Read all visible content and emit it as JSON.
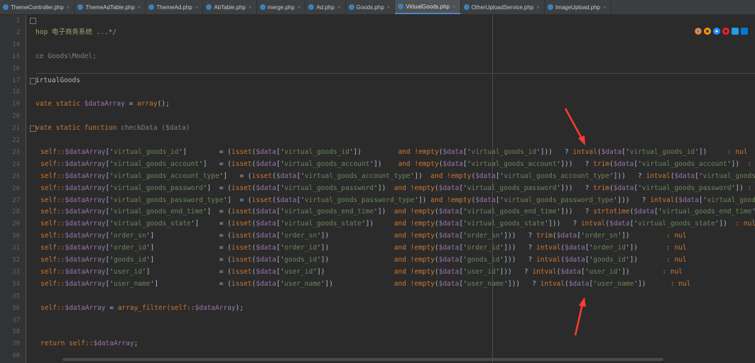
{
  "tabs": [
    {
      "label": "ThemeController.php",
      "active": false
    },
    {
      "label": "ThemeAdTable.php",
      "active": false
    },
    {
      "label": "ThemeAd.php",
      "active": false
    },
    {
      "label": "AbTable.php",
      "active": false
    },
    {
      "label": "merge.php",
      "active": false
    },
    {
      "label": "Ad.php",
      "active": false
    },
    {
      "label": "Goods.php",
      "active": false
    },
    {
      "label": "VirtualGoods.php",
      "active": true
    },
    {
      "label": "OtherUploadService.php",
      "active": false
    },
    {
      "label": "ImageUpload.php",
      "active": false
    }
  ],
  "line_numbers": [
    "1",
    "2",
    "14",
    "15",
    "16",
    "17",
    "18",
    "19",
    "20",
    "21",
    "22",
    "23",
    "24",
    "25",
    "26",
    "27",
    "28",
    "29",
    "30",
    "31",
    "32",
    "33",
    "34",
    "35",
    "36",
    "37",
    "38",
    "39",
    "40"
  ],
  "code": {
    "l2": "hop 电子商务系统 ...*/",
    "l15": "ce Goods\\Model;",
    "l17": "irtualGoods",
    "l19a": "vate static ",
    "l19b": "$dataArray",
    "l19c": " = ",
    "l19d": "array",
    "l19e": "();",
    "l21a": "vate static function ",
    "l21b": "checkData ($data)",
    "rows": [
      {
        "key": "virtual_goods_id",
        "pad": "        ",
        "pad2": "         ",
        "fn": "intval",
        "k": "virtual_goods_id",
        "tail": "     : nul"
      },
      {
        "key": "virtual_goods_account",
        "pad": "   ",
        "pad2": "    ",
        "fn": "trim",
        "k": "virtual_goods_account",
        "tail": "  : nul"
      },
      {
        "key": "virtual_goods_account_type",
        "pad": "   ",
        "pad2": "  ",
        "fn": "intval",
        "k": "virtual_goods_",
        "tail": ""
      },
      {
        "key": "virtual_goods_password",
        "pad": "  ",
        "pad2": "  ",
        "fn": "trim",
        "k": "virtual_goods_password",
        "tail": " : nul"
      },
      {
        "key": "virtual_goods_password_type",
        "pad": "  ",
        "pad2": " ",
        "fn": "intval",
        "k": "virtual_goods_",
        "tail": ""
      },
      {
        "key": "virtual_goods_end_time",
        "pad": "  ",
        "pad2": "  ",
        "fn": "strtotime",
        "k": "virtual_goods_end_time",
        "tail": " : nul"
      },
      {
        "key": "virtual_goods_state",
        "pad": "     ",
        "pad2": "     ",
        "fn": "intval",
        "k": "virtual_goods_state",
        "tail": "  : nul"
      },
      {
        "key": "order_sn",
        "pad": "                ",
        "pad2": "                ",
        "fn": "trim",
        "k": "order_sn",
        "tail": "         : nul"
      },
      {
        "key": "order_id",
        "pad": "                ",
        "pad2": "                ",
        "fn": "intval",
        "k": "order_id",
        "tail": "       : nul"
      },
      {
        "key": "goods_id",
        "pad": "                ",
        "pad2": "                ",
        "fn": "intval",
        "k": "goods_id",
        "tail": "       : nul"
      },
      {
        "key": "user_id",
        "pad": "                 ",
        "pad2": "                 ",
        "fn": "intval",
        "k": "user_id",
        "tail": "        : nul"
      },
      {
        "key": "user_name",
        "pad": "               ",
        "pad2": "               ",
        "fn": "intval",
        "k": "user_name",
        "tail": "      : nul"
      }
    ],
    "l36a": "self::",
    "l36b": "$dataArray",
    "l36c": " = ",
    "l36d": "array_filter",
    "l36e": "(self::",
    "l36f": "$dataArray",
    "l36g": ");",
    "l39a": "return ",
    "l39b": "self::",
    "l39c": "$dataArray",
    "l39d": ";"
  },
  "colors": {
    "arrow": "#ff3b2f",
    "keyword": "#cc7832",
    "string": "#6a8759",
    "variable": "#9876aa"
  }
}
